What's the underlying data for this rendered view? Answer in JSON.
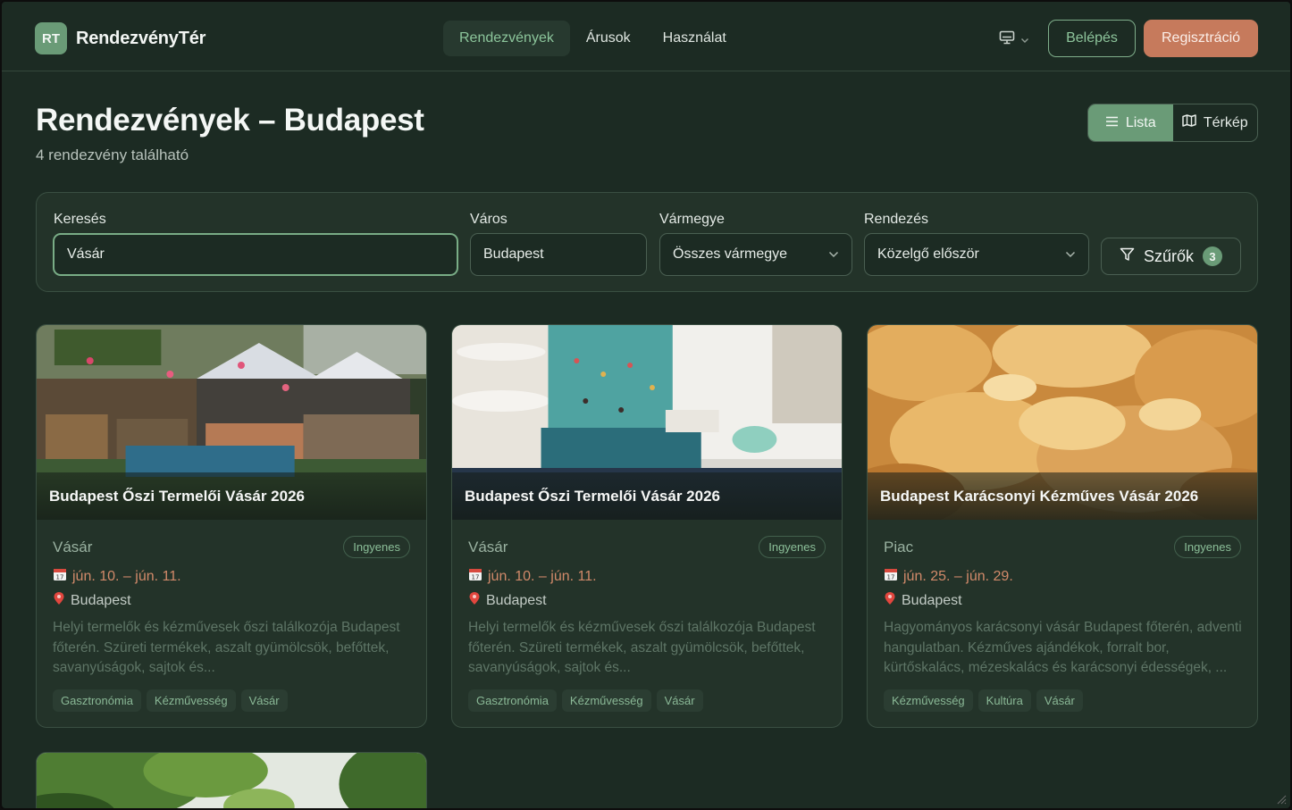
{
  "brand": {
    "badge": "RT",
    "name": "RendezvényTér",
    "accent": "#6a9b77",
    "cta_color": "#c67a5c"
  },
  "nav": {
    "items": [
      {
        "label": "Rendezvények",
        "active": true
      },
      {
        "label": "Árusok",
        "active": false
      },
      {
        "label": "Használat",
        "active": false
      }
    ]
  },
  "header": {
    "display_icon": "monitor-icon",
    "login_label": "Belépés",
    "register_label": "Regisztráció"
  },
  "page": {
    "title": "Rendezvények – Budapest",
    "subtitle": "4 rendezvény található"
  },
  "view_toggle": {
    "list_label": "Lista",
    "map_label": "Térkép",
    "active": "list"
  },
  "filters": {
    "search_label": "Keresés",
    "search_value": "Vásár",
    "city_label": "Város",
    "city_value": "Budapest",
    "county_label": "Vármegye",
    "county_value": "Összes vármegye",
    "sort_label": "Rendezés",
    "sort_value": "Közelgő először",
    "filters_button": "Szűrők",
    "filters_count": "3"
  },
  "events": [
    {
      "title": "Budapest Őszi Termelői Vásár 2026",
      "category": "Vásár",
      "price": "Ingyenes",
      "date": "jún. 10. – jún. 11.",
      "city": "Budapest",
      "description": "Helyi termelők és kézművesek őszi találkozója Budapest főterén. Szüreti termékek, aszalt gyümölcsök, befőttek, savanyúságok, sajtok és...",
      "tags": [
        "Gasztronómia",
        "Kézművesség",
        "Vásár"
      ]
    },
    {
      "title": "Budapest Őszi Termelői Vásár 2026",
      "category": "Vásár",
      "price": "Ingyenes",
      "date": "jún. 10. – jún. 11.",
      "city": "Budapest",
      "description": "Helyi termelők és kézművesek őszi találkozója Budapest főterén. Szüreti termékek, aszalt gyümölcsök, befőttek, savanyúságok, sajtok és...",
      "tags": [
        "Gasztronómia",
        "Kézművesség",
        "Vásár"
      ]
    },
    {
      "title": "Budapest Karácsonyi Kézműves Vásár 2026",
      "category": "Piac",
      "price": "Ingyenes",
      "date": "jún. 25. – jún. 29.",
      "city": "Budapest",
      "description": "Hagyományos karácsonyi vásár Budapest főterén, adventi hangulatban. Kézműves ajándékok, forralt bor, kürtőskalács, mézeskalács és karácsonyi édességek, ...",
      "tags": [
        "Kézművesség",
        "Kultúra",
        "Vásár"
      ]
    }
  ]
}
